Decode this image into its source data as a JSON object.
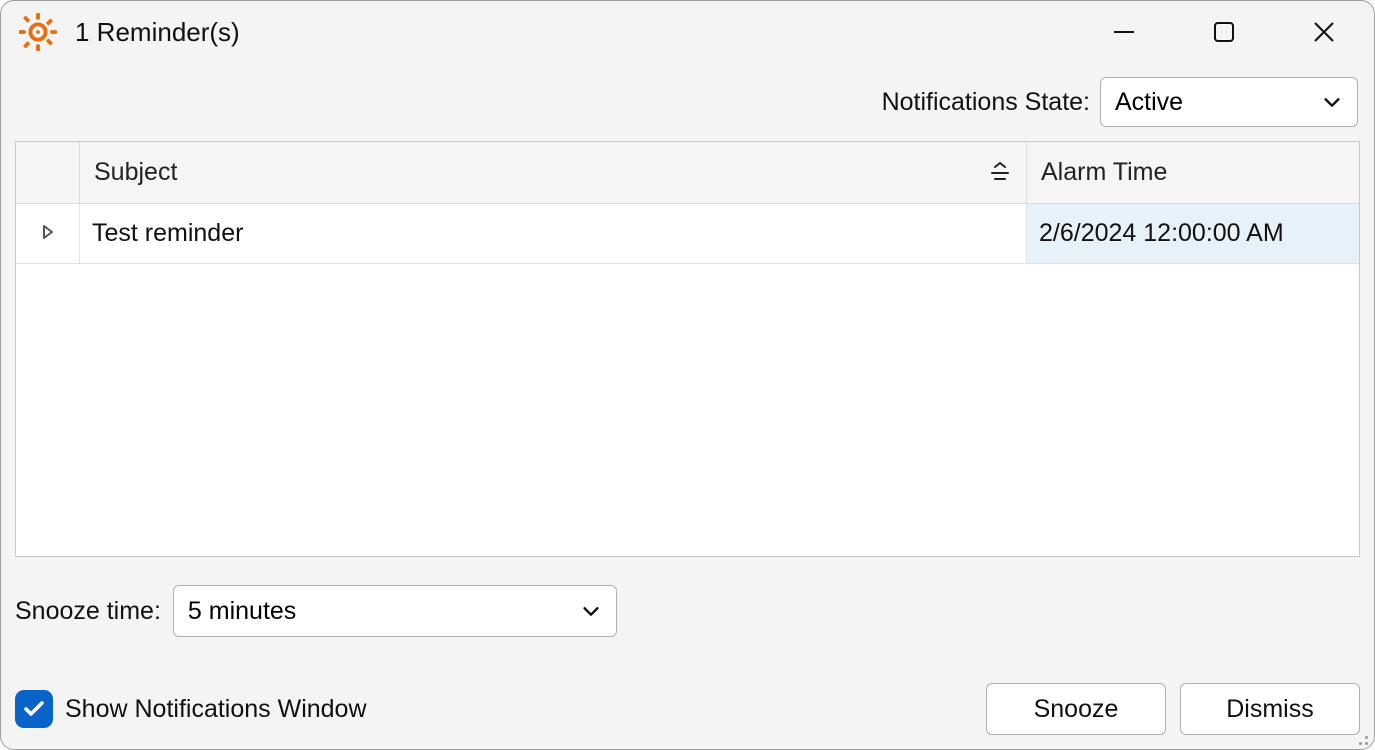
{
  "window": {
    "title": "1 Reminder(s)"
  },
  "state": {
    "label": "Notifications State:",
    "selected": "Active"
  },
  "grid": {
    "columns": {
      "subject": "Subject",
      "alarm": "Alarm Time"
    },
    "rows": [
      {
        "subject": "Test reminder",
        "alarm": "2/6/2024 12:00:00 AM"
      }
    ]
  },
  "snooze": {
    "label": "Snooze time:",
    "selected": "5 minutes"
  },
  "footer": {
    "checkbox_label": "Show Notifications Window",
    "checkbox_checked": true,
    "snooze_btn": "Snooze",
    "dismiss_btn": "Dismiss"
  }
}
